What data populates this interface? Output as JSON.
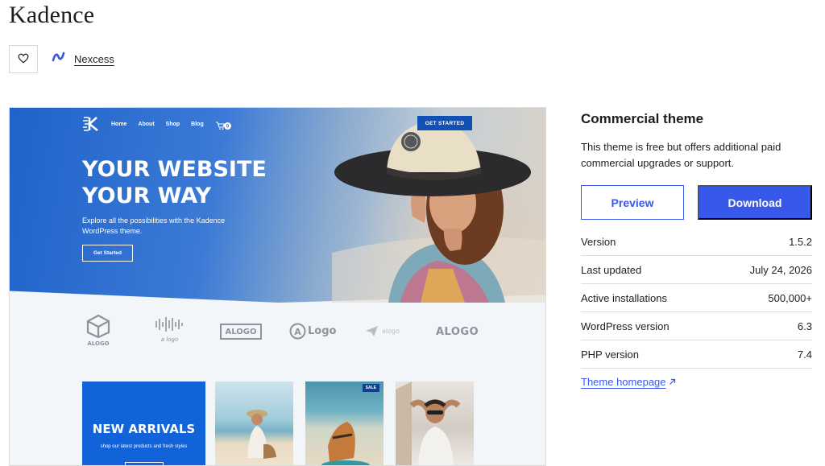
{
  "theme": {
    "title": "Kadence",
    "author": "Nexcess"
  },
  "icons": {
    "favorite": "heart-icon",
    "author": "nexcess-logo-icon",
    "external": "arrow-up-right-icon"
  },
  "preview": {
    "nav": [
      "Home",
      "About",
      "Shop",
      "Blog"
    ],
    "cart_count": "0",
    "cta_top": "GET STARTED",
    "headline_1": "YOUR WEBSITE",
    "headline_2": "YOUR WAY",
    "subtext": "Explore all the possibilities with the Kadence WordPress theme.",
    "hero_button": "Get Started",
    "logos": [
      "ALOGO",
      "a logo",
      "ALOGO",
      "Logo",
      "alogo",
      "ALOGO"
    ],
    "arrivals_title": "NEW ARRIVALS",
    "arrivals_sub": "shop our latest products and fresh styles",
    "sale_badge": "SALE"
  },
  "sidebar": {
    "title": "Commercial theme",
    "description": "This theme is free but offers additional paid commercial upgrades or support.",
    "preview_button": "Preview",
    "download_button": "Download",
    "meta": [
      {
        "label": "Version",
        "value": "1.5.2"
      },
      {
        "label": "Last updated",
        "value": "July 24, 2026"
      },
      {
        "label": "Active installations",
        "value": "500,000+"
      },
      {
        "label": "WordPress version",
        "value": "6.3"
      },
      {
        "label": "PHP version",
        "value": "7.4"
      }
    ],
    "homepage_link": "Theme homepage"
  },
  "colors": {
    "accent": "#3858e9",
    "hero_blue": "#1f63c9",
    "text": "#1e1e1e"
  }
}
